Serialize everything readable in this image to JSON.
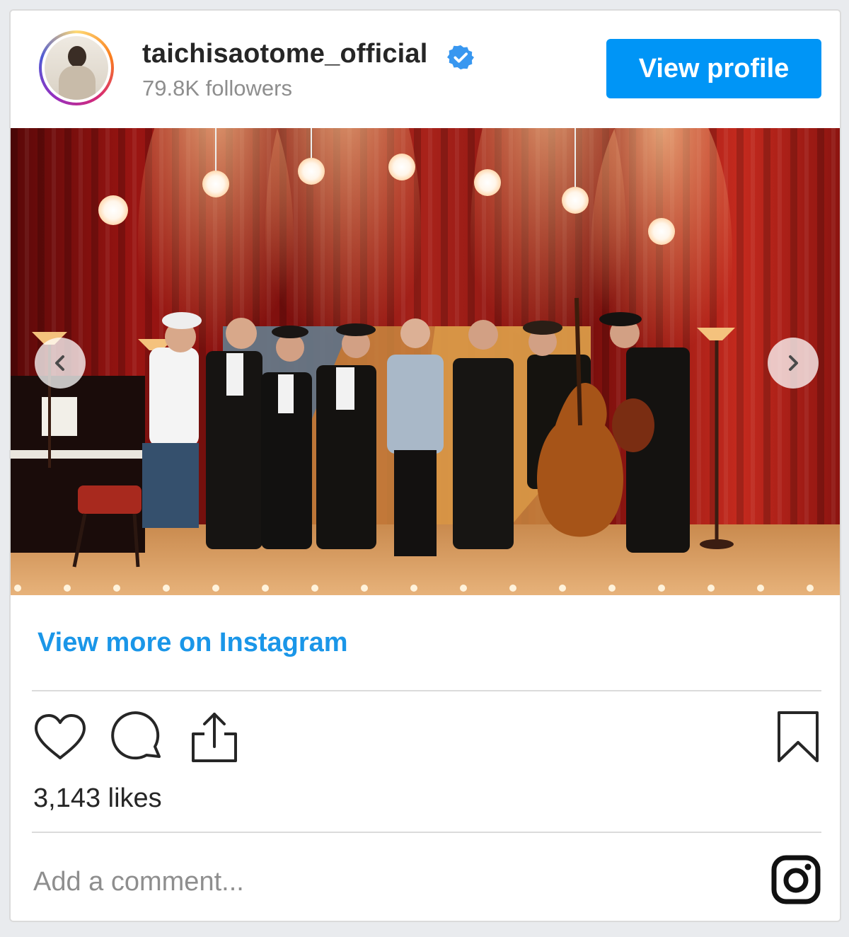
{
  "header": {
    "username": "taichisaotome_official",
    "followers": "79.8K followers",
    "verified": true,
    "view_profile_label": "View profile"
  },
  "post": {
    "image_nav_prev_icon": "chevron-left-icon",
    "image_nav_next_icon": "chevron-right-icon"
  },
  "view_more_label": "View more on Instagram",
  "actions": {
    "like_icon": "heart-icon",
    "comment_icon": "comment-icon",
    "share_icon": "share-icon",
    "save_icon": "bookmark-icon"
  },
  "likes_text": "3,143 likes",
  "comment": {
    "placeholder": "Add a comment..."
  },
  "colors": {
    "accent": "#0095f6",
    "link": "#1a96e8",
    "verified_badge": "#3897f0",
    "border": "#dbdbdb",
    "muted_text": "#8e8e8e"
  }
}
